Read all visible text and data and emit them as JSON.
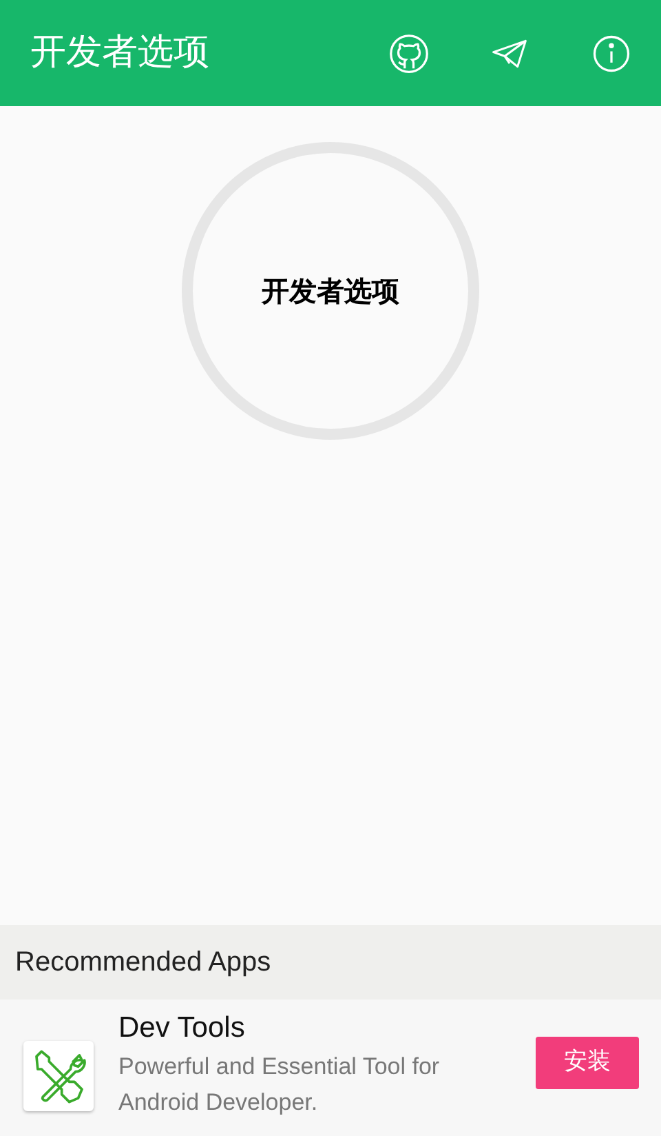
{
  "app_bar": {
    "title": "开发者选项"
  },
  "center": {
    "label": "开发者选项"
  },
  "recommended": {
    "heading": "Recommended Apps",
    "apps": [
      {
        "name": "Dev Tools",
        "description": "Powerful and Essential Tool for Android Developer.",
        "button": "安装"
      }
    ]
  }
}
